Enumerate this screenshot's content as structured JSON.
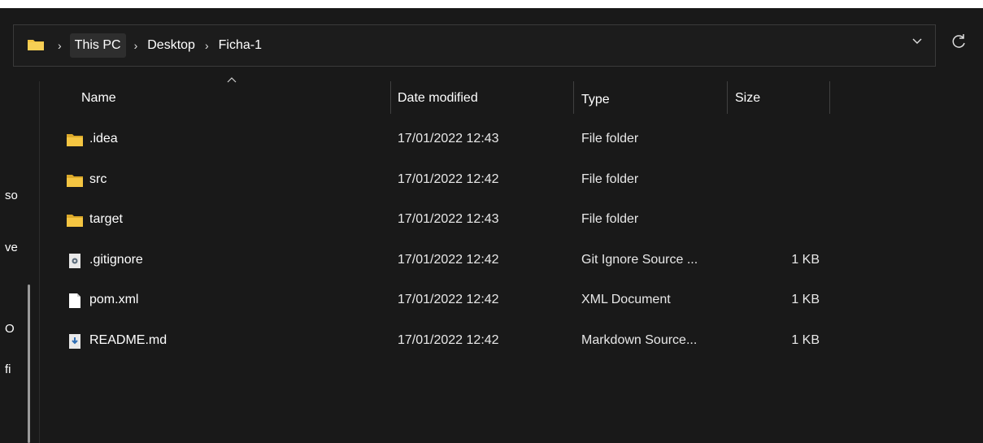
{
  "address": {
    "crumbs": [
      "This PC",
      "Desktop",
      "Ficha-1"
    ],
    "separator": "›"
  },
  "nav": {
    "fragments": [
      "so",
      "ve",
      "O",
      "fi"
    ]
  },
  "columns": {
    "name": "Name",
    "date": "Date modified",
    "type": "Type",
    "size": "Size"
  },
  "files": [
    {
      "name": ".idea",
      "date": "17/01/2022 12:43",
      "type": "File folder",
      "size": "",
      "icon": "folder-icon"
    },
    {
      "name": "src",
      "date": "17/01/2022 12:42",
      "type": "File folder",
      "size": "",
      "icon": "folder-icon"
    },
    {
      "name": "target",
      "date": "17/01/2022 12:43",
      "type": "File folder",
      "size": "",
      "icon": "folder-icon"
    },
    {
      "name": ".gitignore",
      "date": "17/01/2022 12:42",
      "type": "Git Ignore Source ...",
      "size": "1 KB",
      "icon": "gear-file-icon"
    },
    {
      "name": "pom.xml",
      "date": "17/01/2022 12:42",
      "type": "XML Document",
      "size": "1 KB",
      "icon": "blank-file-icon"
    },
    {
      "name": "README.md",
      "date": "17/01/2022 12:42",
      "type": "Markdown Source...",
      "size": "1 KB",
      "icon": "markdown-file-icon"
    }
  ],
  "colors": {
    "background": "#191919",
    "folder": "#f4c542",
    "text": "#ffffff"
  }
}
